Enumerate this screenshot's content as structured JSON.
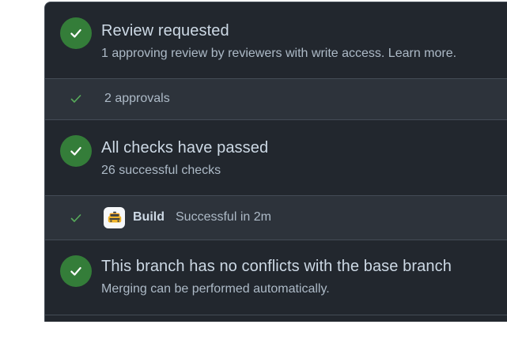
{
  "review": {
    "title": "Review requested",
    "subtitle": "1 approving review by reviewers with write access. Learn more.",
    "approvals_label": "2 approvals"
  },
  "checks": {
    "title": "All checks have passed",
    "subtitle": "26 successful checks",
    "build": {
      "name": "Build",
      "status": "Successful in 2m",
      "icon": "taxi-app-icon"
    }
  },
  "conflicts": {
    "title": "This branch has no conflicts with the base branch",
    "subtitle": "Merging can be performed automatically."
  },
  "colors": {
    "panel_bg": "#22272e",
    "sub_row_bg": "#2d333b",
    "success_green": "#347d39",
    "check_green": "#57ab5a",
    "text_primary": "#cdd9e5",
    "text_secondary": "#adbac7"
  }
}
